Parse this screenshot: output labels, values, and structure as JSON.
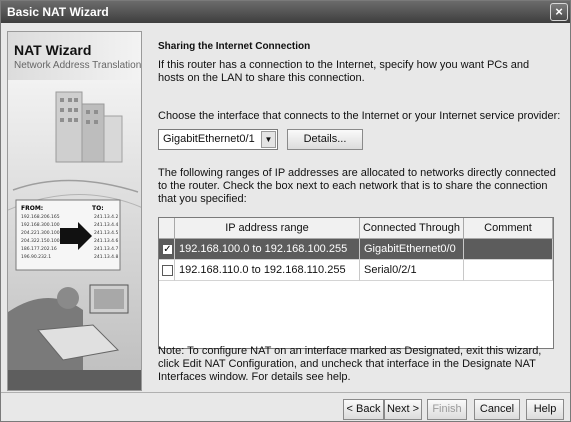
{
  "window": {
    "title": "Basic NAT Wizard",
    "close_glyph": "×"
  },
  "sidebar": {
    "title": "NAT Wizard",
    "subtitle": "Network Address Translation",
    "illustration": {
      "from_label": "FROM:",
      "to_label": "TO:",
      "from_addresses": [
        "192.168.206.165",
        "192.168.300.100",
        "204.221.300.100",
        "204.322.150.100",
        "186.177.202.16",
        "196.90.232.1"
      ],
      "to_addresses": [
        "241.13.4.2",
        "241.13.4.4",
        "241.13.4.5",
        "241.13.4.6",
        "241.13.4.7",
        "241.13.4.8"
      ]
    }
  },
  "content": {
    "heading": "Sharing the Internet Connection",
    "intro": "If this router has a connection to the Internet, specify how you want PCs and hosts on the LAN to share this connection.",
    "choose_label": "Choose the interface that connects to the Internet or your Internet service provider:",
    "interface_select": {
      "value": "GigabitEthernet0/1",
      "arrow": "▼"
    },
    "details_button": "Details...",
    "ranges_text": "The following ranges of IP addresses are allocated to networks directly connected to the router. Check the box next to each network that is to share the connection that you specified:",
    "table": {
      "columns": [
        "",
        "IP address range",
        "Connected Through",
        "Comment"
      ],
      "rows": [
        {
          "checked": true,
          "check_glyph": "✓",
          "range": "192.168.100.0 to 192.168.100.255",
          "through": "GigabitEthernet0/0",
          "comment": ""
        },
        {
          "checked": false,
          "check_glyph": "",
          "range": "192.168.110.0 to 192.168.110.255",
          "through": "Serial0/2/1",
          "comment": ""
        }
      ]
    },
    "note": "Note: To configure NAT on an interface marked as Designated, exit this wizard, click Edit NAT Configuration, and uncheck that interface in the Designate NAT Interfaces window. For details see help."
  },
  "footer": {
    "back": "< Back",
    "next": "Next >",
    "finish": "Finish",
    "cancel": "Cancel",
    "help": "Help"
  }
}
